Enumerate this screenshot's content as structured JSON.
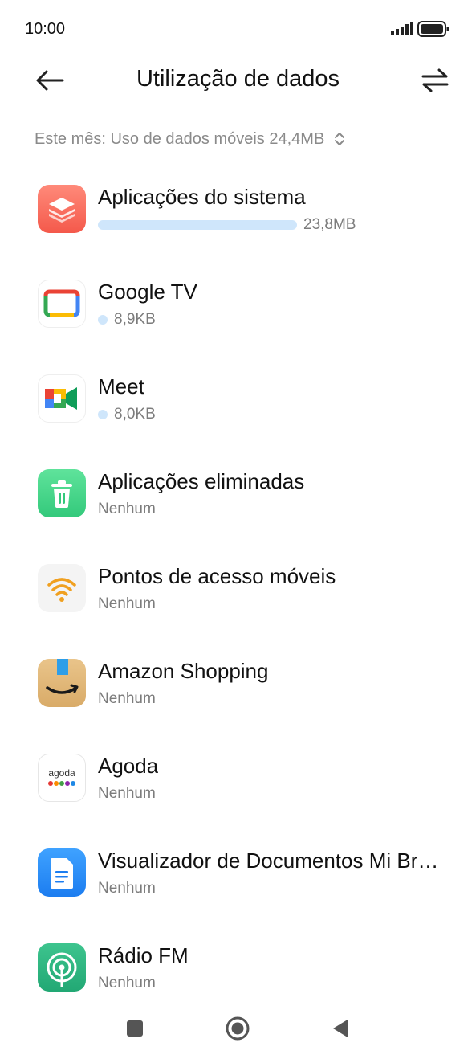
{
  "status_bar": {
    "time": "10:00",
    "signal_icon": "signal-icon",
    "battery_icon": "battery-icon"
  },
  "header": {
    "title": "Utilização de dados",
    "back_icon": "arrow-left-icon",
    "swap_icon": "swap-arrows-icon"
  },
  "filter": {
    "label": "Este mês: Uso de dados móveis 24,4MB",
    "icon": "chevron-up-down-icon"
  },
  "colors": {
    "usage_bar": "#cfe6fb",
    "secondary_text": "#7c7c7c"
  },
  "apps": [
    {
      "name": "Aplicações do sistema",
      "usage": "23,8MB",
      "usage_fraction": 1.0,
      "icon": "layers-icon"
    },
    {
      "name": "Google TV",
      "usage": "8,9KB",
      "usage_fraction": 0.0004,
      "icon": "google-tv-icon"
    },
    {
      "name": "Meet",
      "usage": "8,0KB",
      "usage_fraction": 0.0003,
      "icon": "google-meet-icon"
    },
    {
      "name": "Aplicações eliminadas",
      "usage": "Nenhum",
      "usage_fraction": 0,
      "icon": "trash-icon"
    },
    {
      "name": "Pontos de acesso móveis",
      "usage": "Nenhum",
      "usage_fraction": 0,
      "icon": "wifi-icon"
    },
    {
      "name": "Amazon Shopping",
      "usage": "Nenhum",
      "usage_fraction": 0,
      "icon": "amazon-icon"
    },
    {
      "name": "Agoda",
      "usage": "Nenhum",
      "usage_fraction": 0,
      "icon": "agoda-icon"
    },
    {
      "name": "Visualizador de Documentos Mi Browser",
      "usage": "Nenhum",
      "usage_fraction": 0,
      "icon": "document-icon"
    },
    {
      "name": "Rádio FM",
      "usage": "Nenhum",
      "usage_fraction": 0,
      "icon": "radio-icon"
    }
  ],
  "nav": {
    "recents_icon": "square-icon",
    "home_icon": "circle-home-icon",
    "back_icon": "triangle-back-icon"
  }
}
